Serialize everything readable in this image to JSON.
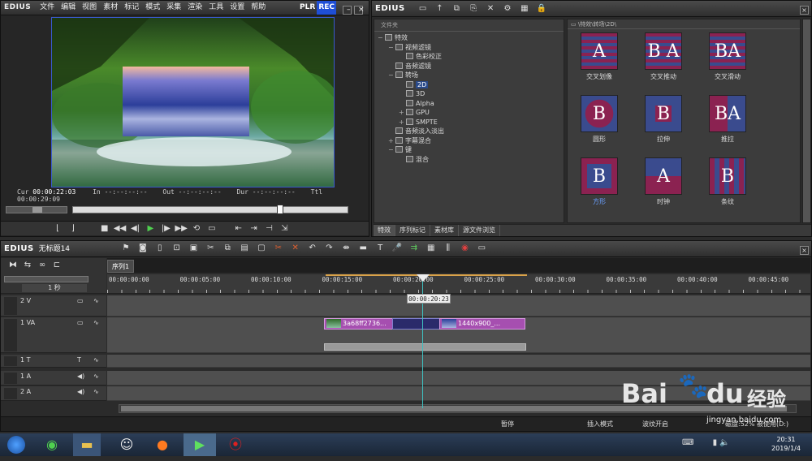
{
  "player": {
    "logo": "EDIUS",
    "menu": [
      "文件",
      "编辑",
      "视图",
      "素材",
      "标记",
      "模式",
      "采集",
      "渲染",
      "工具",
      "设置",
      "帮助"
    ],
    "plr": "PLR",
    "rec": "REC",
    "cur_label": "Cur",
    "cur_value": "00:00:22:03",
    "in_label": "In",
    "in_value": "--:--:--:--",
    "out_label": "Out",
    "out_value": "--:--:--:--",
    "dur_label": "Dur",
    "dur_value": "--:--:--:--",
    "ttl_label": "Ttl",
    "ttl_value": "00:00:29:09",
    "scrub_progress": 0.76
  },
  "effects": {
    "logo": "EDIUS",
    "tree_header": "文件夹",
    "path": "\\特效\\转场\\2D\\",
    "tree": [
      {
        "label": "特效",
        "depth": 0,
        "expander": "−"
      },
      {
        "label": "视频滤镜",
        "depth": 1,
        "expander": "−"
      },
      {
        "label": "色彩校正",
        "depth": 2,
        "expander": ""
      },
      {
        "label": "音频滤镜",
        "depth": 1,
        "expander": ""
      },
      {
        "label": "转场",
        "depth": 1,
        "expander": "−"
      },
      {
        "label": "2D",
        "depth": 2,
        "expander": "",
        "selected": true
      },
      {
        "label": "3D",
        "depth": 2,
        "expander": ""
      },
      {
        "label": "Alpha",
        "depth": 2,
        "expander": ""
      },
      {
        "label": "GPU",
        "depth": 2,
        "expander": "+"
      },
      {
        "label": "SMPTE",
        "depth": 2,
        "expander": "+"
      },
      {
        "label": "音频淡入淡出",
        "depth": 1,
        "expander": ""
      },
      {
        "label": "字幕混合",
        "depth": 1,
        "expander": "+"
      },
      {
        "label": "键",
        "depth": 1,
        "expander": "−"
      },
      {
        "label": "混合",
        "depth": 2,
        "expander": ""
      }
    ],
    "tiles": [
      {
        "label": "交叉划像",
        "glyph": "A"
      },
      {
        "label": "交叉推动",
        "glyph": "B A"
      },
      {
        "label": "交叉滑动",
        "glyph": "BA"
      },
      {
        "label": "圆形",
        "glyph": "B"
      },
      {
        "label": "拉伸",
        "glyph": "B"
      },
      {
        "label": "推拉",
        "glyph": "BA"
      },
      {
        "label": "方形",
        "glyph": "B"
      },
      {
        "label": "时钟",
        "glyph": "A"
      },
      {
        "label": "条纹",
        "glyph": "B"
      }
    ],
    "tabs": [
      "特效",
      "序列标记",
      "素材库",
      "源文件浏览"
    ]
  },
  "timeline": {
    "logo": "EDIUS",
    "project": "无标题14",
    "sequence_tab": "序列1",
    "scale": "1 秒",
    "ruler": [
      "00:00:00:00",
      "00:00:05:00",
      "00:00:10:00",
      "00:00:15:00",
      "00:00:20:00",
      "00:00:25:00",
      "00:00:30:00",
      "00:00:35:00",
      "00:00:40:00",
      "00:00:45:00"
    ],
    "playhead_tc": "00:00:20:23",
    "tracks": [
      {
        "name": "2 V"
      },
      {
        "name": "1 VA"
      },
      {
        "name": "1 T"
      },
      {
        "name": "1 A"
      },
      {
        "name": "2 A"
      }
    ],
    "clip1": "3a68ff2736...",
    "clip2": "1440x900_...",
    "status": [
      "暂停",
      "插入模式",
      "波纹开启",
      "磁盘:52% 被使用(D:)"
    ]
  },
  "taskbar": {
    "time": "20:31",
    "date": "2019/1/4"
  },
  "watermark": {
    "brand": "Bai",
    "cn": "经验",
    "url": "jingyan.baidu.com"
  },
  "colors": {
    "rec": "#1f4fd6",
    "clip": "#a64fb0",
    "playhead": "#3fc0c0"
  }
}
